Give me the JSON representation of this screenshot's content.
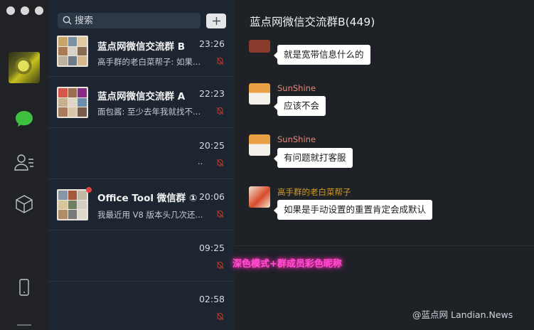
{
  "window": {
    "title": "蓝点网微信交流群B(449)"
  },
  "search": {
    "placeholder": "搜索"
  },
  "chats": [
    {
      "name": "蓝点网微信交流群 B",
      "time": "23:26",
      "preview": "高手群的老白菜帮子: 如果..."
    },
    {
      "name": "蓝点网微信交流群 A",
      "time": "22:23",
      "preview": "面包酱: 至少去年我就找不..."
    },
    {
      "name": "",
      "time": "20:25",
      "preview": ".."
    },
    {
      "name": "Office Tool 微信群 ①",
      "time": "20:06",
      "preview": "我最近用 V8 版本头几次还..."
    },
    {
      "name": "",
      "time": "09:25",
      "preview": ""
    },
    {
      "name": "",
      "time": "02:58",
      "preview": ""
    }
  ],
  "messages": [
    {
      "sender": "",
      "text": "就是宽带信息什么的"
    },
    {
      "sender": "SunShine",
      "text": "应该不会"
    },
    {
      "sender": "SunShine",
      "text": "有问题就打客服"
    },
    {
      "sender": "高手群的老白菜帮子",
      "text": "如果是手动设置的重置肯定会成默认"
    }
  ],
  "overlay": {
    "watermark_red": "深色模式+群成员彩色昵称",
    "watermark_site": "@蓝点网 Landian.News"
  },
  "colors": {
    "accent_green": "#3fbf3f",
    "sender_pink": "#e28a7a",
    "sender_gold": "#d39b1b",
    "unread_red": "#e64340"
  },
  "icons": {
    "search": "search-icon",
    "add": "plus-icon",
    "chat": "chat-bubble-icon",
    "contacts": "contacts-icon",
    "favorites": "cube-icon",
    "phone": "phone-icon",
    "mute": "mute-bell-icon"
  }
}
